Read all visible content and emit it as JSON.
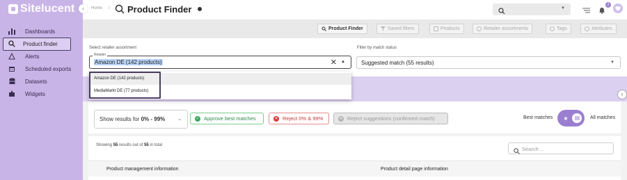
{
  "app": {
    "name": "Sitelucent"
  },
  "sidebar": {
    "collapse_icon": "chevron-left-icon",
    "items": [
      {
        "label": "Dashboards",
        "icon": "bar-chart-icon"
      },
      {
        "label": "Product finder",
        "icon": "search-icon",
        "active": true
      },
      {
        "label": "Alerts",
        "icon": "alert-icon"
      },
      {
        "label": "Scheduled exports",
        "icon": "calendar-icon"
      },
      {
        "label": "Datasets",
        "icon": "database-icon"
      },
      {
        "label": "Widgets",
        "icon": "puzzle-icon"
      }
    ]
  },
  "header": {
    "breadcrumb_home": "Home",
    "breadcrumb_sep": "/",
    "title": "Product Finder",
    "search_placeholder": "Q",
    "notification_count": "2"
  },
  "toolbar": {
    "buttons": [
      {
        "label": "Product Finder",
        "icon": "search-icon",
        "active": true
      },
      {
        "label": "Saved filters",
        "icon": "filter-icon"
      },
      {
        "label": "Products",
        "icon": "box-icon"
      },
      {
        "label": "Retailer assortments",
        "icon": "store-icon"
      },
      {
        "label": "Tags",
        "icon": "tag-icon"
      },
      {
        "label": "Attributes",
        "icon": "list-icon"
      }
    ]
  },
  "filters": {
    "assortment_label": "Select retailer assortment",
    "retailer_legend": "Retailer",
    "retailer_value": "Amazon DE (142 products)",
    "match_label": "Filter by match status",
    "match_value": "Suggested match (55 results)"
  },
  "dropdown": {
    "options": [
      "Amazon DE (142 products)",
      "MediaMarkt DE (77 products)"
    ]
  },
  "results": {
    "range_prefix": "Show results for ",
    "range_value": "0% - 99%",
    "approve_label": "Approve best matches",
    "reject_label": "Reject 0% & 99%",
    "reject_suggestions_label": "Reject suggestions (confirmed match)",
    "best_matches_label": "Best matches",
    "all_matches_label": "All matches"
  },
  "table": {
    "showing_prefix": "Showing ",
    "showing_count": "55",
    "showing_middle": " results out of ",
    "showing_total": "55",
    "showing_suffix": " in total",
    "search_placeholder": "Search ...",
    "columns": [
      "Product management information",
      "Product detail page information"
    ]
  },
  "colors": {
    "sidebar_bg": "#c9b4e8",
    "accent": "#9a7fd1",
    "approve": "#3aa95a",
    "reject": "#d93a3a"
  }
}
